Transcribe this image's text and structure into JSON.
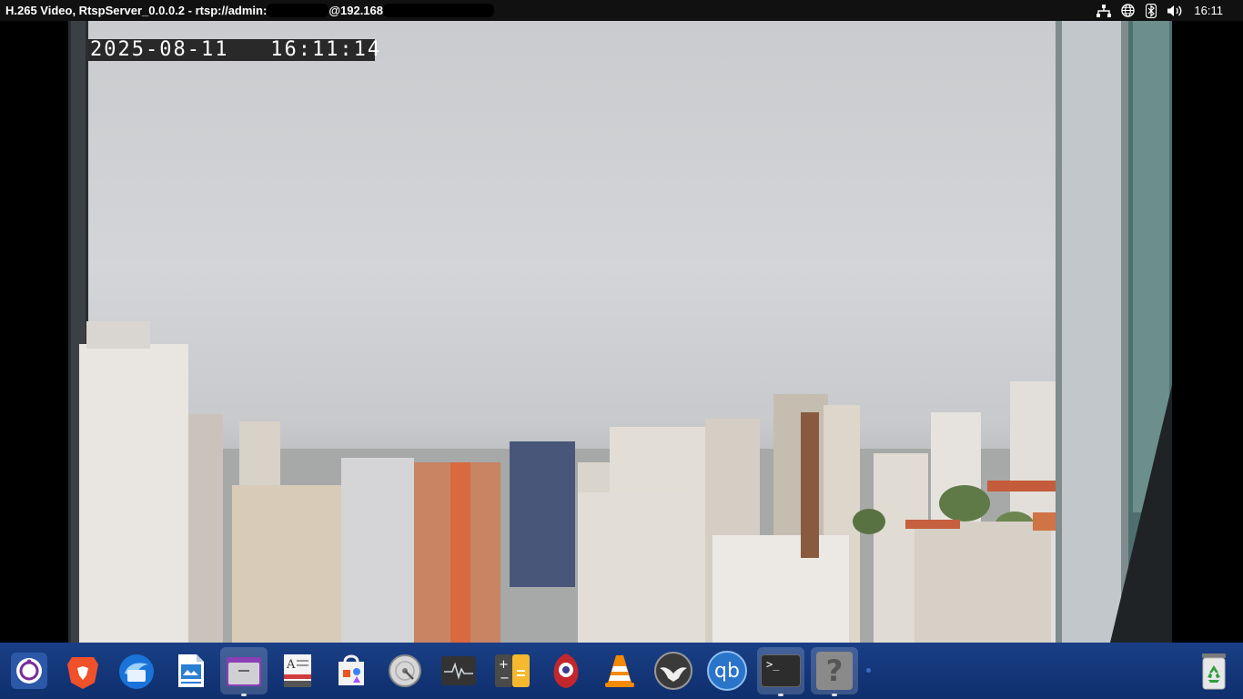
{
  "window": {
    "title_part1": "H.265 Video, RtspServer_0.0.0.2 - rtsp://admin:",
    "title_part2": "@192.168"
  },
  "tray": {
    "icons": [
      "network-icon",
      "globe-icon",
      "bluetooth-icon",
      "volume-icon"
    ],
    "clock": "16:11"
  },
  "video": {
    "osd_date": "2025-08-11",
    "osd_time": "16:11:14"
  },
  "dock": {
    "apps": [
      {
        "name": "ubuntu-launcher",
        "icon": "ubuntu-icon"
      },
      {
        "name": "brave-browser",
        "icon": "brave-icon"
      },
      {
        "name": "thunderbird",
        "icon": "thunderbird-icon"
      },
      {
        "name": "libreoffice-writer",
        "icon": "writer-icon"
      },
      {
        "name": "files",
        "icon": "folder-icon",
        "active": true
      },
      {
        "name": "document-viewer",
        "icon": "document-viewer-icon"
      },
      {
        "name": "app-center",
        "icon": "app-center-icon"
      },
      {
        "name": "disk-usage",
        "icon": "disk-icon"
      },
      {
        "name": "system-monitor",
        "icon": "system-monitor-icon"
      },
      {
        "name": "calculator",
        "icon": "calculator-icon"
      },
      {
        "name": "rclone-browser",
        "icon": "red-bird-icon"
      },
      {
        "name": "vlc",
        "icon": "vlc-cone-icon"
      },
      {
        "name": "bird-app",
        "icon": "bird-silhouette-icon"
      },
      {
        "name": "qbittorrent",
        "icon": "qbittorrent-icon",
        "label": "qb"
      },
      {
        "name": "terminal",
        "icon": "terminal-icon",
        "label": ">_",
        "active": true
      },
      {
        "name": "unknown-app",
        "icon": "question-icon",
        "label": "?",
        "active": true
      }
    ],
    "trash": {
      "icon": "trash-icon"
    }
  },
  "colors": {
    "dock": "#1a3f86",
    "topbar": "#111111",
    "sky": "#cfd1d4"
  }
}
